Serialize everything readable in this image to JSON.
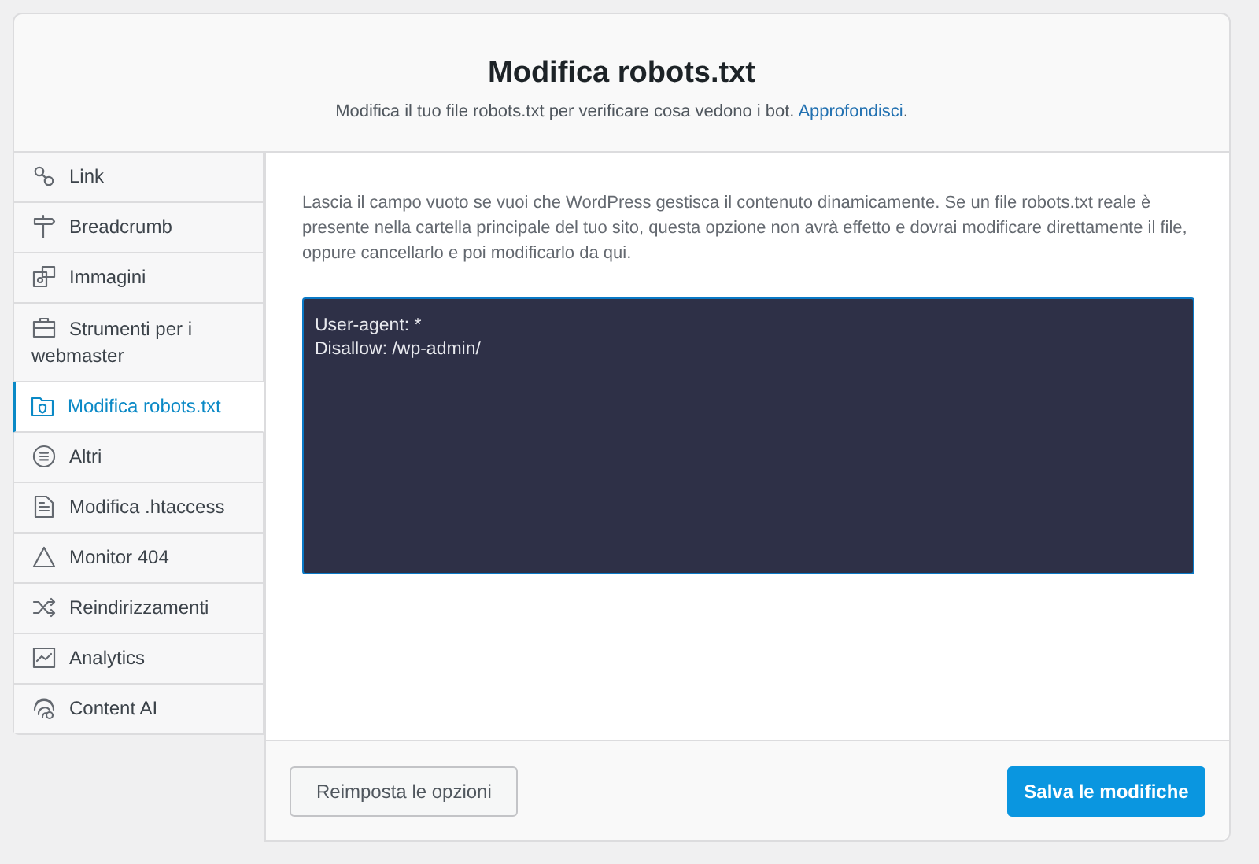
{
  "header": {
    "title": "Modifica robots.txt",
    "subtitle": "Modifica il tuo file robots.txt per verificare cosa vedono i bot. ",
    "link": "Approfondisci",
    "after_link": "."
  },
  "sidebar": {
    "items": [
      {
        "label": "Link",
        "selected": false
      },
      {
        "label": "Breadcrumb",
        "selected": false
      },
      {
        "label": "Immagini",
        "selected": false
      },
      {
        "label": "Strumenti per i webmaster",
        "selected": false
      },
      {
        "label": "Modifica robots.txt",
        "selected": true
      },
      {
        "label": "Altri",
        "selected": false
      },
      {
        "label": "Modifica .htaccess",
        "selected": false
      },
      {
        "label": "Monitor 404",
        "selected": false
      },
      {
        "label": "Reindirizzamenti",
        "selected": false
      },
      {
        "label": "Analytics",
        "selected": false
      },
      {
        "label": "Content AI",
        "selected": false
      }
    ]
  },
  "content": {
    "description": "Lascia il campo vuoto se vuoi che WordPress gestisca il contenuto dinamicamente. Se un file robots.txt reale è presente nella cartella principale del tuo sito, questa opzione non avrà effetto e dovrai modificare direttamente il file, oppure cancellarlo e poi modificarlo da qui.",
    "editor": {
      "value": "User-agent: *\nDisallow: /wp-admin/"
    }
  },
  "footer": {
    "reset_button": "Reimposta le opzioni",
    "save_button": "Salva le modifiche"
  }
}
